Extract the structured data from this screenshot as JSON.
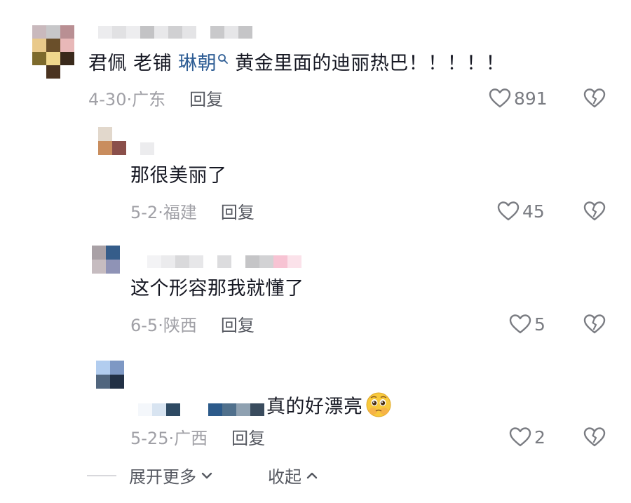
{
  "comments": [
    {
      "text_prefix": "君佩 老铺 ",
      "mention": "琳朝",
      "text_suffix": " 黄金里面的迪丽热巴！！！！！",
      "date": "4-30",
      "location": "广东",
      "reply_label": "回复",
      "likes": "891"
    },
    {
      "text": "那很美丽了",
      "date": "5-2",
      "location": "福建",
      "reply_label": "回复",
      "likes": "45"
    },
    {
      "text": "这个形容那我就懂了",
      "date": "6-5",
      "location": "陕西",
      "reply_label": "回复",
      "likes": "5"
    },
    {
      "text": "真的好漂亮",
      "emoji": "pleading-face-emoji",
      "date": "5-25",
      "location": "广西",
      "reply_label": "回复",
      "likes": "2"
    }
  ],
  "footer": {
    "expand_label": "展开更多",
    "collapse_label": "收起"
  },
  "icons": {
    "like": "heart-outline-icon",
    "dislike": "broken-heart-icon",
    "mention": "search-icon",
    "expand": "chevron-down-icon",
    "collapse": "chevron-up-icon"
  },
  "colors": {
    "mention": "#2f5e95",
    "meta": "#a0a0a6",
    "text": "#161823"
  }
}
